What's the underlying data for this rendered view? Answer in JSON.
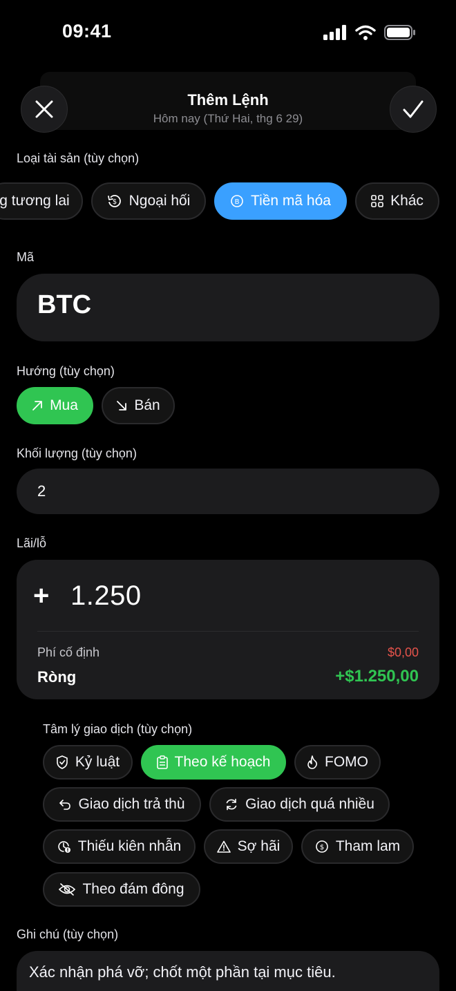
{
  "status_bar": {
    "time": "09:41"
  },
  "header": {
    "title": "Thêm Lệnh",
    "subtitle": "Hôm nay (Thứ Hai, thg 6 29)",
    "close_icon": "close-icon",
    "confirm_icon": "checkmark-icon"
  },
  "asset_type": {
    "label": "Loại tài sản (tùy chọn)",
    "options": [
      {
        "label": "g tương lai",
        "icon": ""
      },
      {
        "label": "Ngoại hối",
        "icon": "forex-icon"
      },
      {
        "label": "Tiền mã hóa",
        "icon": "bitcoin-icon",
        "selected": true
      },
      {
        "label": "Khác",
        "icon": "grid-icon"
      }
    ]
  },
  "ticker": {
    "label": "Mã",
    "value": "BTC"
  },
  "direction": {
    "label": "Hướng (tùy chọn)",
    "options": [
      {
        "label": "Mua",
        "icon": "arrow-up-right-icon",
        "selected": true
      },
      {
        "label": "Bán",
        "icon": "arrow-down-right-icon"
      }
    ]
  },
  "volume": {
    "label": "Khối lượng (tùy chọn)",
    "value": "2"
  },
  "pnl": {
    "label": "Lãi/lỗ",
    "sign": "+",
    "value": "1.250",
    "fee_label": "Phí cố định",
    "fee_value": "$0,00",
    "net_label": "Ròng",
    "net_value": "+$1.250,00"
  },
  "psychology": {
    "label": "Tâm lý giao dịch (tùy chọn)",
    "options": [
      {
        "label": "Kỷ luật",
        "icon": "shield-check-icon"
      },
      {
        "label": "Theo kế hoạch",
        "icon": "clipboard-icon",
        "selected": true
      },
      {
        "label": "FOMO",
        "icon": "flame-icon"
      },
      {
        "label": "Giao dịch trả thù",
        "icon": "undo-icon"
      },
      {
        "label": "Giao dịch quá nhiều",
        "icon": "refresh-icon"
      },
      {
        "label": "Thiếu kiên nhẫn",
        "icon": "clock-alert-icon"
      },
      {
        "label": "Sợ hãi",
        "icon": "warning-icon"
      },
      {
        "label": "Tham lam",
        "icon": "dollar-circle-icon"
      },
      {
        "label": "Theo đám đông",
        "icon": "eye-off-icon"
      }
    ]
  },
  "note": {
    "label": "Ghi chú (tùy chọn)",
    "value": "Xác nhận phá vỡ; chốt một phần tại mục tiêu."
  },
  "colors": {
    "accent_blue": "#3aa0ff",
    "accent_green": "#30c552",
    "negative_red": "#e5534b",
    "card_bg": "#1c1c1e"
  }
}
